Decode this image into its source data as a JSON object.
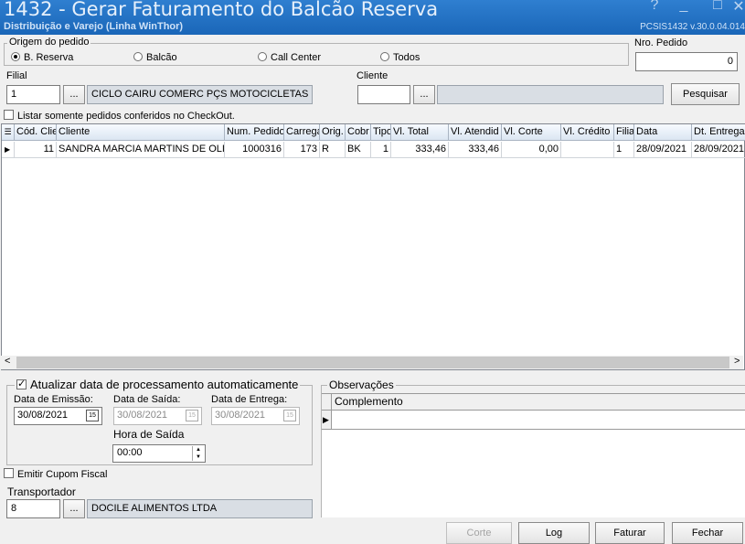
{
  "window": {
    "title": "1432 - Gerar Faturamento do Balcão Reserva",
    "subtitle": "Distribuição e Varejo (Linha WinThor)",
    "version": "PCSIS1432  v.30.0.04.014",
    "help_icon": "?",
    "minimize_icon": "_",
    "maximize_icon": "□",
    "close_icon": "✕"
  },
  "origem": {
    "legend": "Origem do pedido",
    "options": [
      "B. Reserva",
      "Balcão",
      "Call Center",
      "Todos"
    ],
    "selected": "B. Reserva"
  },
  "nro_pedido": {
    "label": "Nro. Pedido",
    "value": "0"
  },
  "filial": {
    "label": "Filial",
    "code": "1",
    "name": "CICLO CAIRU COMERC PÇS MOTOCICLETAS LTDA"
  },
  "cliente": {
    "label": "Cliente",
    "code": "",
    "name": ""
  },
  "browse_label": "...",
  "pesquisar_label": "Pesquisar",
  "checkout_filter": {
    "label": "Listar somente pedidos conferidos no CheckOut.",
    "checked": false
  },
  "grid": {
    "columns": [
      "Cód. Clie",
      "Cliente",
      "Num. Pedido",
      "Carrega",
      "Orig.",
      "Cobr",
      "Tipo",
      "Vl. Total",
      "Vl. Atendid",
      "Vl. Corte",
      "Vl. Crédito",
      "Filia",
      "Data",
      "Dt. Entrega"
    ],
    "rows": [
      [
        "11",
        "SANDRA MARCIA MARTINS DE OLIVE",
        "1000316",
        "173",
        "R",
        "BK",
        "1",
        "333,46",
        "333,46",
        "0,00",
        "",
        "1",
        "28/09/2021",
        "28/09/2021"
      ]
    ],
    "scroll_left": "<",
    "scroll_right": ">"
  },
  "processamento": {
    "label": "Atualizar data de processamento automaticamente",
    "checked": true,
    "emissao_label": "Data de Emissão:",
    "emissao_value": "30/08/2021",
    "saida_label": "Data de Saída:",
    "saida_value": "30/08/2021",
    "entrega_label": "Data de Entrega:",
    "entrega_value": "30/08/2021",
    "hora_label": "Hora de Saída",
    "hora_value": "00:00",
    "calendar_glyph": "15"
  },
  "observacoes": {
    "legend": "Observações",
    "column": "Complemento"
  },
  "cupom_fiscal": {
    "label": "Emitir Cupom Fiscal",
    "checked": false
  },
  "transportador": {
    "label": "Transportador",
    "code": "8",
    "name": "DOCILE ALIMENTOS LTDA"
  },
  "buttons": {
    "corte": "Corte",
    "log": "Log",
    "faturar": "Faturar",
    "fechar": "Fechar"
  }
}
